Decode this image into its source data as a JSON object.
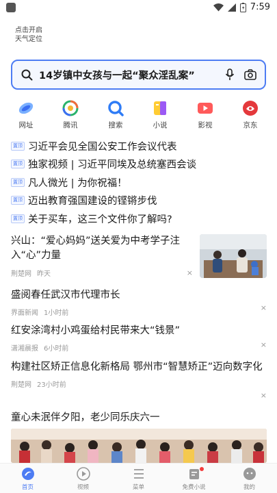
{
  "status_bar": {
    "time": "7:59"
  },
  "weather": {
    "line1": "点击开启",
    "line2": "天气定位"
  },
  "search": {
    "query": "14岁镇中女孩与一起“聚众淫乱案”"
  },
  "shortcuts": [
    {
      "label": "网址",
      "icon": "web-icon"
    },
    {
      "label": "腾讯",
      "icon": "tencent-icon"
    },
    {
      "label": "搜索",
      "icon": "search-icon"
    },
    {
      "label": "小说",
      "icon": "novel-icon"
    },
    {
      "label": "影视",
      "icon": "video-icon"
    },
    {
      "label": "京东",
      "icon": "jd-icon"
    }
  ],
  "pinned": {
    "tag": "置顶",
    "items": [
      "习近平会见全国公安工作会议代表",
      "独家视频 | 习近平同埃及总统塞西会谈",
      "凡人微光 | 为你祝福！",
      "迈出教育强国建设的铿锵步伐",
      "关于买车，这三个文件你了解吗?"
    ]
  },
  "news": [
    {
      "title": "兴山：“爱心妈妈”送关爱为中考学子注入“心”力量",
      "source": "荆楚网",
      "time": "昨天"
    },
    {
      "title": "盛阅春任武汉市代理市长",
      "source": "界面新闻",
      "time": "1小时前"
    },
    {
      "title": "红安涂湾村小鸡蛋给村民带来大“钱景”",
      "source": "潇湘晨报",
      "time": "6小时前"
    },
    {
      "title": "构建社区矫正信息化新格局 鄂州市“智慧矫正”迈向数字化",
      "source": "荆楚网",
      "time": "23小时前"
    },
    {
      "title": "童心未泯伴夕阳，老少同乐庆六一"
    }
  ],
  "close_glyph": "×",
  "bottom_nav": [
    {
      "label": "首页",
      "icon": "home-icon"
    },
    {
      "label": "视频",
      "icon": "play-icon"
    },
    {
      "label": "菜单",
      "icon": "menu-icon"
    },
    {
      "label": "免费小说",
      "icon": "book-icon"
    },
    {
      "label": "我的",
      "icon": "profile-icon"
    }
  ],
  "colors": {
    "accent": "#4d7cf3",
    "badge_red": "#f23c3c"
  }
}
